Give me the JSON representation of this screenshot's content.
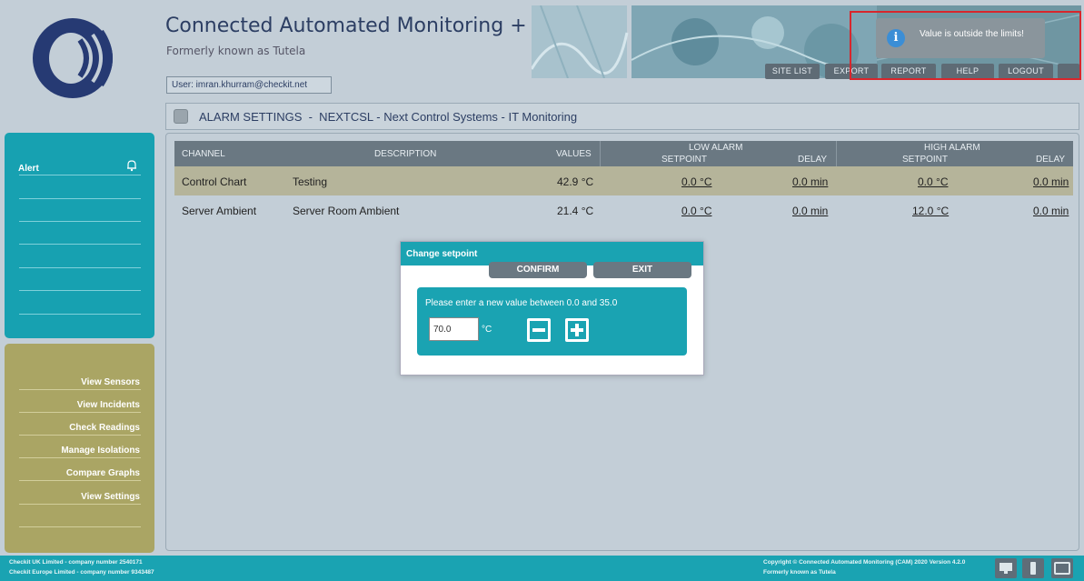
{
  "header": {
    "title": "Connected Automated Monitoring +",
    "subtitle": "Formerly known as Tutela",
    "user_label": "User: imran.khurram@checkit.net"
  },
  "nav": {
    "site_list": "SITE LIST",
    "export": "EXPORT",
    "report": "REPORT",
    "help": "HELP",
    "logout": "LOGOUT"
  },
  "toast": {
    "message": "Value is outside the limits!",
    "icon": "info-icon"
  },
  "breadcrumb": {
    "text": "ALARM SETTINGS  -  NEXTCSL - Next Control Systems - IT Monitoring",
    "icon": "settings-page-icon"
  },
  "sidebar": {
    "alert_label": "Alert",
    "alert_icon": "bell-icon",
    "menu": [
      {
        "label": "View Sensors"
      },
      {
        "label": "View Incidents"
      },
      {
        "label": "Check Readings"
      },
      {
        "label": "Manage Isolations"
      },
      {
        "label": "Compare Graphs"
      },
      {
        "label": "View Settings"
      }
    ]
  },
  "table": {
    "headers": {
      "channel": "CHANNEL",
      "description": "DESCRIPTION",
      "values": "VALUES",
      "low_alarm": "LOW ALARM",
      "low_setpoint": "SETPOINT",
      "low_delay": "DELAY",
      "high_alarm": "HIGH ALARM",
      "high_setpoint": "SETPOINT",
      "high_delay": "DELAY"
    },
    "rows": [
      {
        "channel": "Control Chart",
        "description": "Testing",
        "value": "42.9 °C",
        "low_setpoint": "0.0 °C",
        "low_delay": "0.0 min",
        "high_setpoint": "0.0 °C",
        "high_delay": "0.0 min"
      },
      {
        "channel": "Server Ambient",
        "description": "Server Room Ambient",
        "value": "21.4 °C",
        "low_setpoint": "0.0 °C",
        "low_delay": "0.0 min",
        "high_setpoint": "12.0 °C",
        "high_delay": "0.0 min"
      }
    ]
  },
  "dialog": {
    "title": "Change setpoint",
    "confirm": "CONFIRM",
    "exit": "EXIT",
    "message": "Please enter a new value between 0.0 and 35.0",
    "input_value": "70.0",
    "unit": "°C"
  },
  "footer": {
    "left_line1": "Checkit UK Limited - company number 2540171",
    "left_line2": "Checkit Europe Limited - company number 9343487",
    "right_line1": "Copyright © Connected Automated Monitoring (CAM) 2020 Version 4.2.0",
    "right_line2": "Formerly known as Tutela"
  },
  "colors": {
    "teal": "#1aa3b2",
    "olive": "#aaa564",
    "navy": "#2c3e63",
    "alert_red": "#d8262c"
  }
}
